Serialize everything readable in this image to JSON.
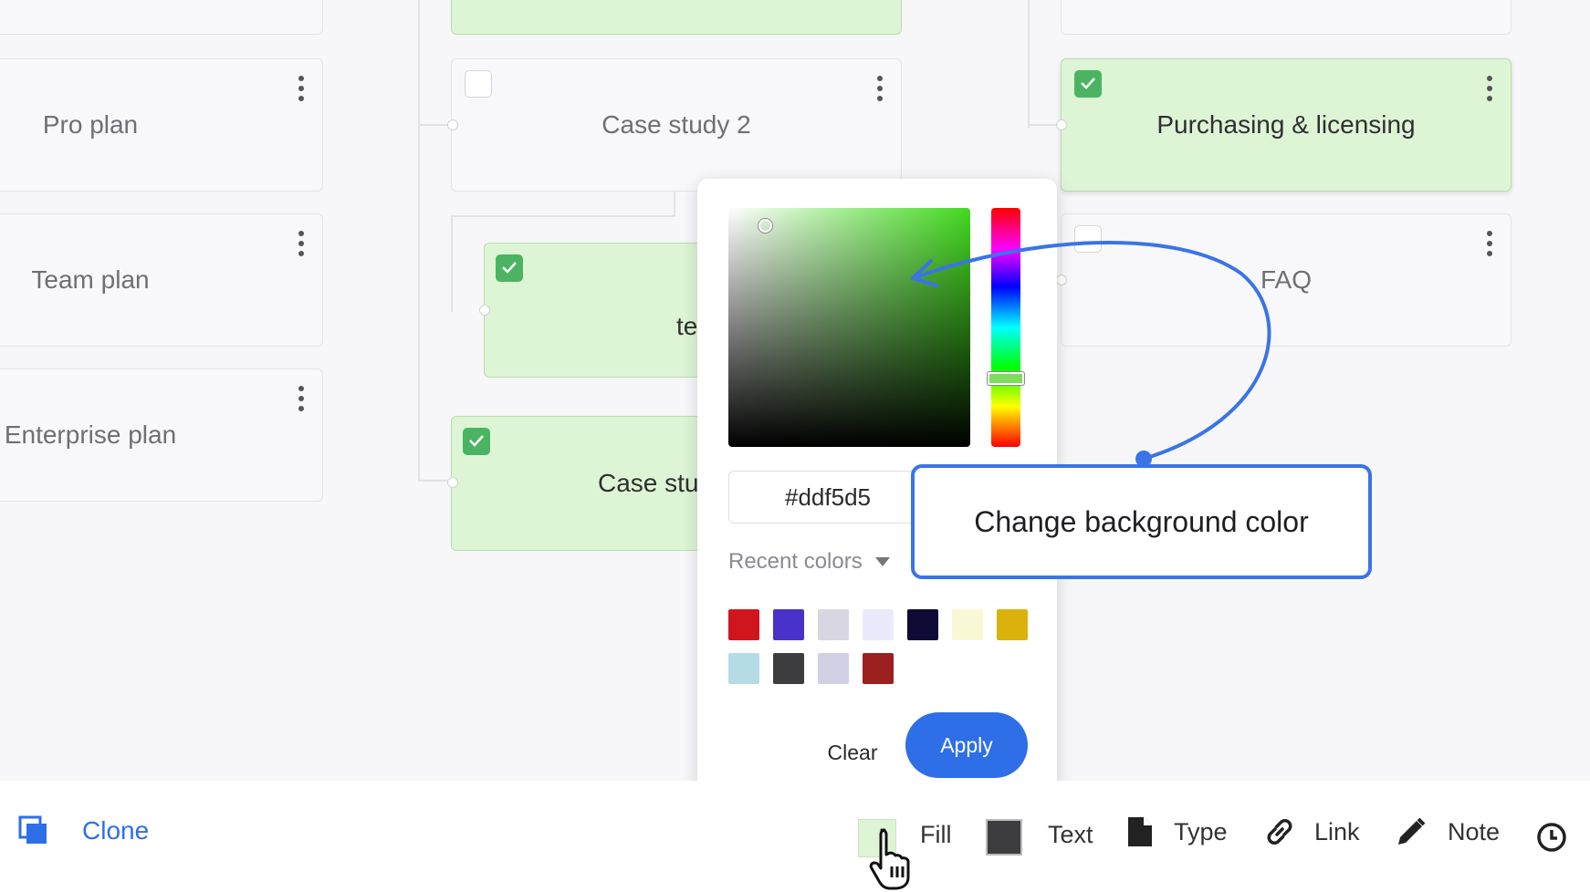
{
  "canvas": {
    "left_column": [
      {
        "label": "Pro plan"
      },
      {
        "label": "Team plan"
      },
      {
        "label": "Enterprise plan"
      }
    ],
    "middle_column": [
      {
        "label": "Case study 2"
      },
      {
        "label": "te"
      },
      {
        "label": "Case stu"
      }
    ],
    "right_column": [
      {
        "label": "Purchasing & licensing"
      },
      {
        "label": "FAQ"
      }
    ]
  },
  "color_picker": {
    "hex_value": "#ddf5d5",
    "recent_label": "Recent colors",
    "recent_colors": [
      "#d0161c",
      "#4932c9",
      "#d8d6e0",
      "#ebeafc",
      "#0f0a36",
      "#f8f9d4",
      "#dab20b",
      "#b5dce4",
      "#3d3d3f",
      "#d1cfe4",
      "#9c2020"
    ],
    "clear_label": "Clear",
    "apply_label": "Apply"
  },
  "callout": {
    "text": "Change background color"
  },
  "toolbar": {
    "clone_label": "Clone",
    "fill_label": "Fill",
    "text_label": "Text",
    "type_label": "Type",
    "link_label": "Link",
    "note_label": "Note",
    "fill_color": "#ddf5d5",
    "text_color": "#3d3d3f"
  }
}
